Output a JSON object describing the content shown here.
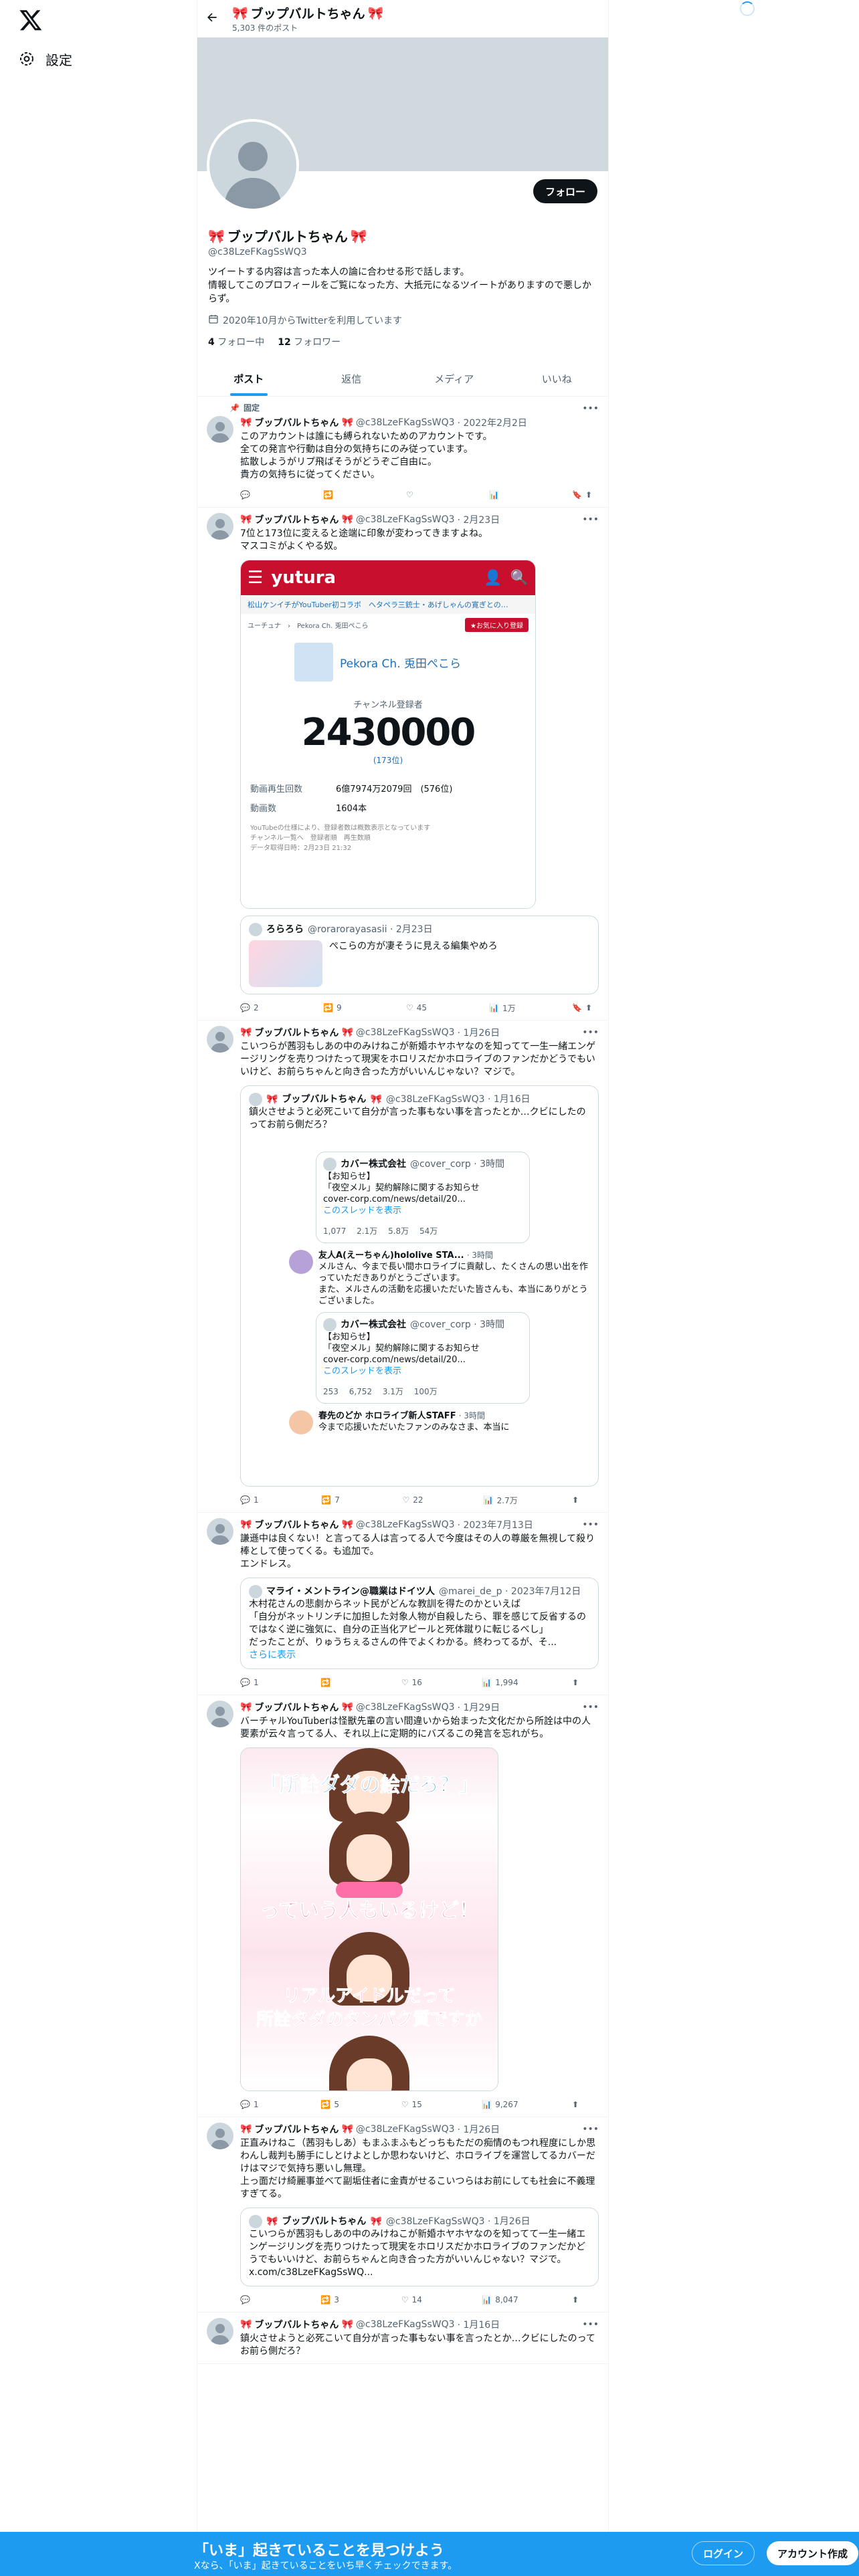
{
  "nav": {
    "settings_label": "設定"
  },
  "header": {
    "title": "ブップバルトちゃん",
    "post_count": "5,303 件のポスト"
  },
  "profile": {
    "name": "ブップバルトちゃん",
    "handle": "@c38LzeFKagSsWQ3",
    "follow_label": "フォロー",
    "bio": "ツイートする内容は言った本人の論に合わせる形で話します。\n情報してこのプロフィールをご覧になった方、大抵元になるツイートがありますので悪しからず。",
    "joined": "2020年10月からTwitterを利用しています",
    "following_count": "4",
    "following_label": "フォロー中",
    "followers_count": "12",
    "followers_label": "フォロワー"
  },
  "tabs": [
    "ポスト",
    "返信",
    "メディア",
    "いいね"
  ],
  "tweets": [
    {
      "pinned_label": "固定",
      "name": "ブップバルトちゃん",
      "handle": "@c38LzeFKagSsWQ3",
      "date": "· 2022年2月2日",
      "text": "このアカウントは誰にも縛られないためのアカウントです。\n全ての発言や行動は自分の気持ちにのみ従っています。\n拡散しようがリプ飛ばそうがどうぞご自由に。\n貴方の気持ちに従ってください。",
      "replies": "",
      "retweets": "",
      "likes": "",
      "views": ""
    },
    {
      "name": "ブップバルトちゃん",
      "handle": "@c38LzeFKagSsWQ3",
      "date": "· 2月23日",
      "text": "7位と173位に変えると途端に印象が変わってきますよね。\nマスコミがよくやる奴。",
      "yutura": {
        "logo": "yutura",
        "nav": "松山ケンイチがYouTuber初コラボ　ヘタペラ三銃士・あげしゃんの寛ぎとの…",
        "crumb": "ユーチュナ　›　Pekora Ch. 兎田ぺこら",
        "fav": "★お気に入り登録",
        "channel": "Pekora Ch. 兎田ぺこら",
        "sub_label": "チャンネル登録者",
        "sub_count": "2430000",
        "rank": "(173位)",
        "views_label": "動画再生回数",
        "views_value": "6億7974万2079回　(576位)",
        "videos_label": "動画数",
        "videos_value": "1604本",
        "note": "YouTubeの仕様により、登録者数は概数表示となっています\nチャンネル一覧へ　登録者順　再生数順\nデータ取得日時：2月23日 21:32"
      },
      "quote": {
        "name": "ろらろら",
        "handle": "@rorarorayasasii · 2月23日",
        "text": "ぺこらの方が凄そうに見える編集やめろ"
      },
      "replies": "2",
      "retweets": "9",
      "likes": "45",
      "views": "1万"
    },
    {
      "name": "ブップバルトちゃん",
      "handle": "@c38LzeFKagSsWQ3",
      "date": "· 1月26日",
      "text": "こいつらが茜羽もしあの中のみけねこが新婚ホヤホヤなのを知ってて一生一緒エンゲージリングを売りつけたって現実をホロリスだかホロライブのファンだかどうでもいいけど、お前らちゃんと向き合った方がいいんじゃない？マジで。",
      "quote": {
        "name": "ブップバルトちゃん",
        "handle": "@c38LzeFKagSsWQ3 · 1月16日",
        "text": "鎮火させようと必死こいて自分が言った事もない事を言ったとか…クビにしたのってお前ら側だろ？",
        "inner1": {
          "name": "カバー株式会社",
          "handle": "@cover_corp · 3時間",
          "text": "【お知らせ】\n「夜空メル」契約解除に関するお知らせ\ncover-corp.com/news/detail/20...",
          "link": "このスレッドを表示",
          "stats": "1,077　 2.1万　 5.8万　 54万"
        },
        "reply": {
          "name": "友人A(えーちゃん)hololive STA...",
          "handle": "· 3時間",
          "text": "メルさん、今まで長い間ホロライブに貢献し、たくさんの思い出を作っていただきありがとうございます。\nまた、メルさんの活動を応援いただいた皆さんも、本当にありがとうございました。"
        },
        "inner2": {
          "name": "カバー株式会社",
          "handle": "@cover_corp · 3時間",
          "text": "【お知らせ】\n「夜空メル」契約解除に関するお知らせ\ncover-corp.com/news/detail/20...",
          "link": "このスレッドを表示",
          "stats": "253　 6,752　 3.1万　 100万"
        },
        "reply2": {
          "name": "春先のどか ホロライブ新人STAFF",
          "handle": "· 3時間",
          "text": "今まで応援いただいたファンのみなさま、本当に"
        }
      },
      "replies": "1",
      "retweets": "7",
      "likes": "22",
      "views": "2.7万"
    },
    {
      "name": "ブップバルトちゃん",
      "handle": "@c38LzeFKagSsWQ3",
      "date": "· 2023年7月13日",
      "text": "謙遜中は良くない！と言ってる人は言ってる人で今度はその人の尊厳を無視して殺り棒として使ってくる。も追加で。\nエンドレス。",
      "quote": {
        "name": "マライ・メントライン@職業はドイツ人",
        "handle": "@marei_de_p · 2023年7月12日",
        "text": "木村花さんの悲劇からネット民がどんな教訓を得たのかといえば\n「自分がネットリンチに加担した対象人物が自殺したら、罪を感じて反省するのではなく逆に強気に、自分の正当化アピールと死体蹴りに転じるべし」\nだったことが、りゅうちぇるさんの件でよくわかる。終わってるが、そ...",
        "more": "さらに表示"
      },
      "replies": "1",
      "retweets": "",
      "likes": "16",
      "views": "1,994"
    },
    {
      "name": "ブップバルトちゃん",
      "handle": "@c38LzeFKagSsWQ3",
      "date": "· 1月29日",
      "text": "バーチャルYouTuberは怪獣先輩の言い間違いから始まった文化だから所詮は中の人要素が云々言ってる人、それ以上に定期的にバズるこの発言を忘れがち。",
      "illus": {
        "line1": "「所詮ダダの絵だろ？」",
        "line2": "っていう人もいるけど！",
        "line3": "リアルアイドルだって",
        "line4": "所詮タダのタンパク質ですから！"
      },
      "replies": "1",
      "retweets": "5",
      "likes": "15",
      "views": "9,267"
    },
    {
      "name": "ブップバルトちゃん",
      "handle": "@c38LzeFKagSsWQ3",
      "date": "· 1月26日",
      "text": "正直みけねこ（茜羽もしあ）もまふまふもどっちもただの痴情のもつれ程度にしか思わんし裁判も勝手にしとけよとしか思わないけど、ホロライブを運営してるカバーだけはマジで気持ち悪いし無理。\n上っ面だけ綺麗事並べて副垢住者に金責がせるこいつらはお前にしても社会に不義理すぎてる。",
      "quote": {
        "name": "ブップバルトちゃん",
        "handle": "@c38LzeFKagSsWQ3 · 1月26日",
        "text": "こいつらが茜羽もしあの中のみけねこが新婚ホヤホヤなのを知ってて一生一緒エンゲージリングを売りつけたって現実をホロリスだかホロライブのファンだかどうでもいいけど、お前らちゃんと向き合った方がいいんじゃない？マジで。 x.com/c38LzeFKagSsWQ..."
      },
      "replies": "",
      "retweets": "3",
      "likes": "14",
      "views": "8,047"
    },
    {
      "name": "ブップバルトちゃん",
      "handle": "@c38LzeFKagSsWQ3",
      "date": "· 1月16日",
      "text": "鎮火させようと必死こいて自分が言った事もない事を言ったとか…クビにしたのってお前ら側だろ？"
    }
  ],
  "bottom": {
    "title": "「いま」起きていることを見つけよう",
    "subtitle": "Xなら、「いま」起きていることをいち早くチェックできます。",
    "login": "ログイン",
    "signup": "アカウント作成"
  }
}
